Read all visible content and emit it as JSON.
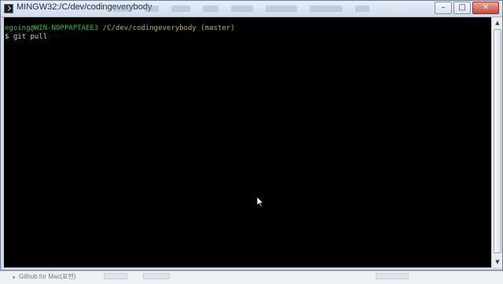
{
  "window": {
    "title": "MINGW32:/C/dev/codingeverybody",
    "minimize_glyph": "–",
    "maximize_glyph": "□",
    "close_glyph": "✕"
  },
  "terminal": {
    "prompt_user": "egoing@WIN-NOPPAPTAEE3",
    "prompt_path": "/C/dev/codingeverybody",
    "prompt_branch": "(master)",
    "prompt_symbol": "$",
    "command": "git pull"
  },
  "scrollbar": {
    "up_glyph": "▲",
    "down_glyph": "▼"
  },
  "statusbar": {
    "item": "Github for Mac(표현)"
  },
  "icons": {
    "app": "terminal-icon",
    "mouse": "mouse-cursor-icon"
  }
}
